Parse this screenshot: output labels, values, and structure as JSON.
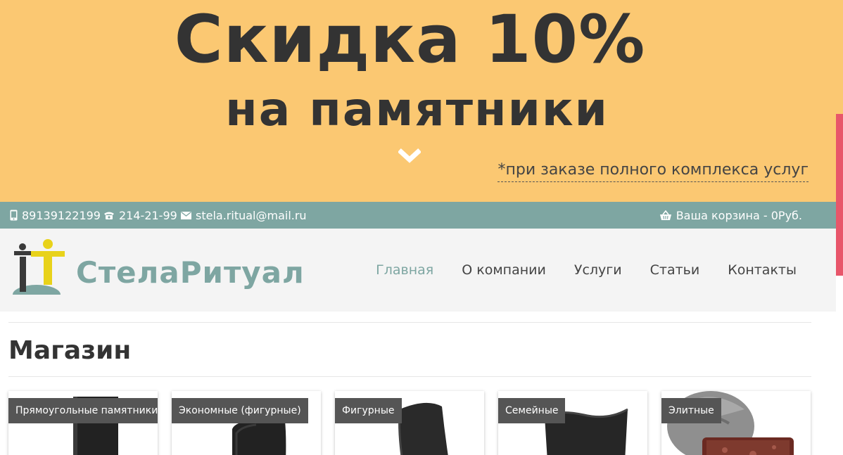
{
  "promo": {
    "title": "Скидка 10%",
    "subtitle": "на памятники",
    "note": "*при заказе полного комплекса услуг",
    "bg_color": "#fbc872"
  },
  "contacts": {
    "mobile": "89139122199",
    "phone": "214-21-99",
    "email": "stela.ritual@mail.ru",
    "cart": "Ваша корзина - 0Руб.",
    "bg_color": "#7ea6a2"
  },
  "logo": {
    "text": "СтелаРитуал"
  },
  "nav": {
    "items": [
      {
        "label": "Главная",
        "active": true
      },
      {
        "label": "О компании",
        "active": false
      },
      {
        "label": "Услуги",
        "active": false
      },
      {
        "label": "Статьи",
        "active": false
      },
      {
        "label": "Контакты",
        "active": false
      }
    ],
    "active_color": "#7ea6a2"
  },
  "shop": {
    "title": "Магазин",
    "categories": [
      {
        "label": "Прямоугольные памятники"
      },
      {
        "label": "Экономные (фигурные)"
      },
      {
        "label": "Фигурные"
      },
      {
        "label": "Семейные"
      },
      {
        "label": "Элитные"
      }
    ]
  }
}
